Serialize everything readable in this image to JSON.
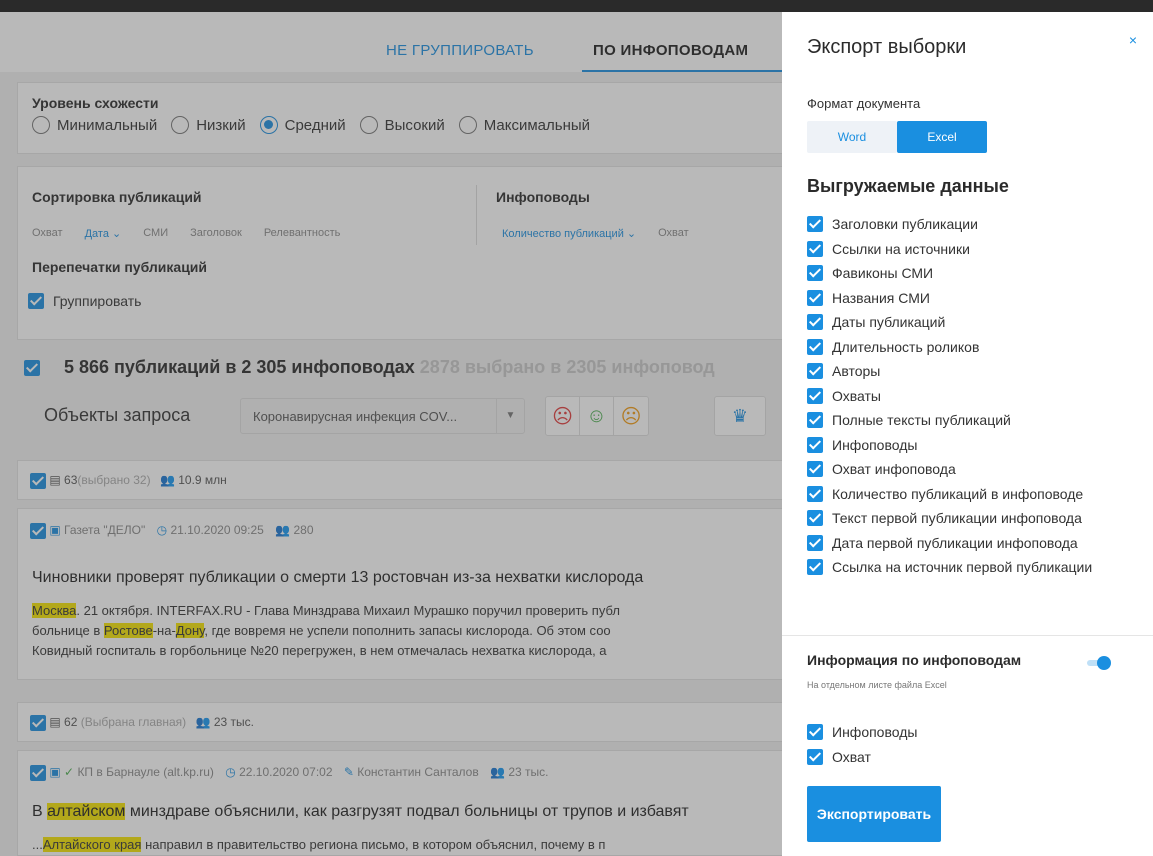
{
  "tabs": {
    "tab1": "НЕ ГРУППИРОВАТЬ",
    "tab2": "ПО ИНФОПОВОДАМ"
  },
  "similarity": {
    "title": "Уровень схожести",
    "options": [
      "Минимальный",
      "Низкий",
      "Средний",
      "Высокий",
      "Максимальный"
    ],
    "selected": "Средний"
  },
  "sorting": {
    "title": "Сортировка публикаций",
    "options": [
      "Охват",
      "Дата ⌄",
      "СМИ",
      "Заголовок",
      "Релевантность"
    ],
    "info_title": "Инфоповоды",
    "info_options": [
      "Количество публикаций ⌄",
      "Охват"
    ],
    "reprints_title": "Перепечатки публикаций",
    "group_label": "Группировать"
  },
  "summary": {
    "main": "5 866 публикаций в 2 305 инфоповодах",
    "muted": "2878 выбрано в 2305 инфоповод"
  },
  "objects": {
    "label": "Объекты запроса",
    "select_value": "Коронавирусная инфекция COV..."
  },
  "groups": [
    {
      "head_count": "63",
      "head_note": "(выбрано 32)",
      "head_reach": "10.9 млн",
      "source": "Газета \"ДЕЛО\"",
      "time": "21.10.2020 09:25",
      "reach": "280",
      "title": "Чиновники проверят публикации о смерти 13 ростовчан из-за нехватки кислорода",
      "line1_hl": "Москва",
      "line1_rest": ". 21 октября. INTERFAX.RU - Глава Минздрава Михаил Мурашко поручил проверить публ",
      "line2_pre": "больнице в ",
      "line2_hl1": "Ростове",
      "line2_mid": "-на-",
      "line2_hl2": "Дону",
      "line2_rest": ", где вовремя не успели пополнить запасы кислорода. Об этом соо",
      "line3": "Ковидный госпиталь в горбольнице №20 перегружен, в нем отмечалась нехватка кислорода, а"
    },
    {
      "head_count": "62",
      "head_note": "(Выбрана главная)",
      "head_reach": "23 тыс.",
      "source": "КП в Барнауле (alt.kp.ru)",
      "time": "22.10.2020 07:02",
      "author": "Константин Санталов",
      "reach": "23 тыс.",
      "title_pre": "В ",
      "title_hl": "алтайском",
      "title_rest": " минздраве объяснили, как разгрузят подвал больницы от трупов и избавят",
      "line1_pre": "...",
      "line1_hl": "Алтайского края",
      "line1_rest": " направил в правительство региона письмо, в котором объяснил, почему в п"
    }
  ],
  "panel": {
    "title": "Экспорт выборки",
    "close": "×",
    "format_label": "Формат документа",
    "format_word": "Word",
    "format_excel": "Excel",
    "data_title": "Выгружаемые данные",
    "options": [
      "Заголовки публикации",
      "Ссылки на источники",
      "Фавиконы СМИ",
      "Названия СМИ",
      "Даты публикаций",
      "Длительность роликов",
      "Авторы",
      "Охваты",
      "Полные тексты публикаций",
      "Инфоповоды",
      "Охват инфоповода",
      "Количество публикаций в инфоповоде",
      "Текст первой публикации инфоповода",
      "Дата первой публикации инфоповода",
      "Ссылка на источник первой публикации"
    ],
    "info_title": "Информация по инфоповодам",
    "info_sub": "На отдельном листе файла Excel",
    "info_options": [
      "Инфоповоды",
      "Охват"
    ],
    "export_label": "Экспортировать"
  }
}
